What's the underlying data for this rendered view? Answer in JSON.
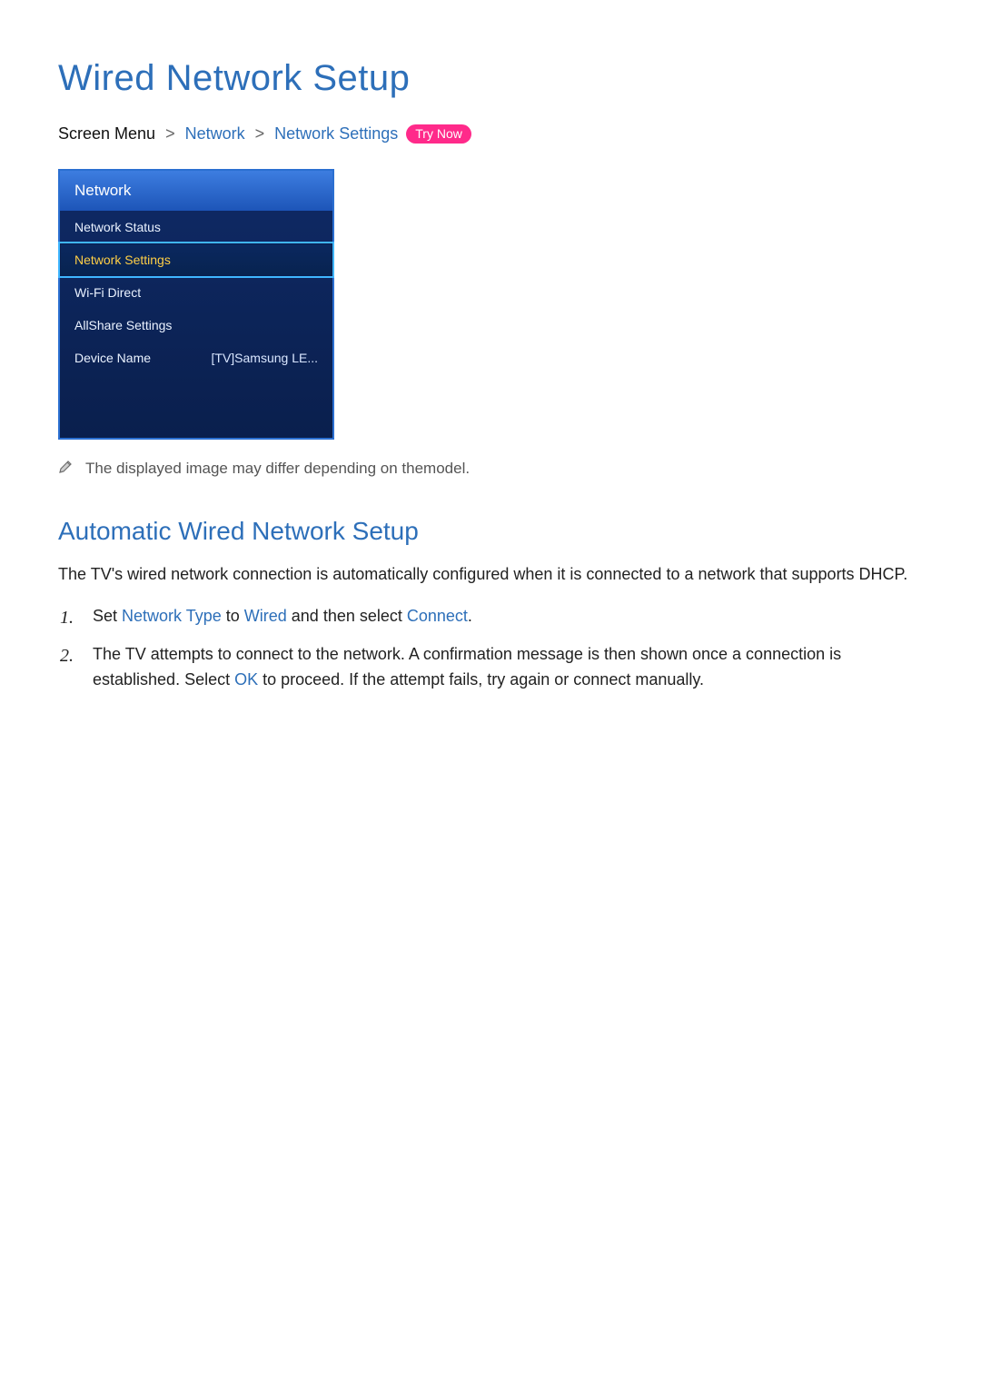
{
  "page": {
    "title": "Wired Network Setup"
  },
  "breadcrumb": {
    "lead": "Screen Menu",
    "sep": ">",
    "network": "Network",
    "network_settings": "Network Settings",
    "try_now": "Try Now"
  },
  "tv_panel": {
    "title": "Network",
    "items": [
      {
        "label": "Network Status",
        "value": ""
      },
      {
        "label": "Network Settings",
        "value": "",
        "highlight": true
      },
      {
        "label": "Wi-Fi Direct",
        "value": ""
      },
      {
        "label": "AllShare Settings",
        "value": ""
      },
      {
        "label": "Device Name",
        "value": "[TV]Samsung LE..."
      }
    ]
  },
  "note": "The displayed image may differ depending on themodel.",
  "section": {
    "title": "Automatic Wired Network Setup",
    "intro": "The TV's wired network connection is automatically configured when it is connected to a network that supports DHCP.",
    "steps": {
      "s1": {
        "pre": "Set ",
        "k1": "Network Type",
        "mid1": " to ",
        "k2": "Wired",
        "mid2": " and then select ",
        "k3": "Connect",
        "post": "."
      },
      "s2": {
        "pre": "The TV attempts to connect to the network. A confirmation message is then shown once a connection is established. Select ",
        "k1": "OK",
        "post": " to proceed. If the attempt fails, try again or connect manually."
      }
    }
  }
}
